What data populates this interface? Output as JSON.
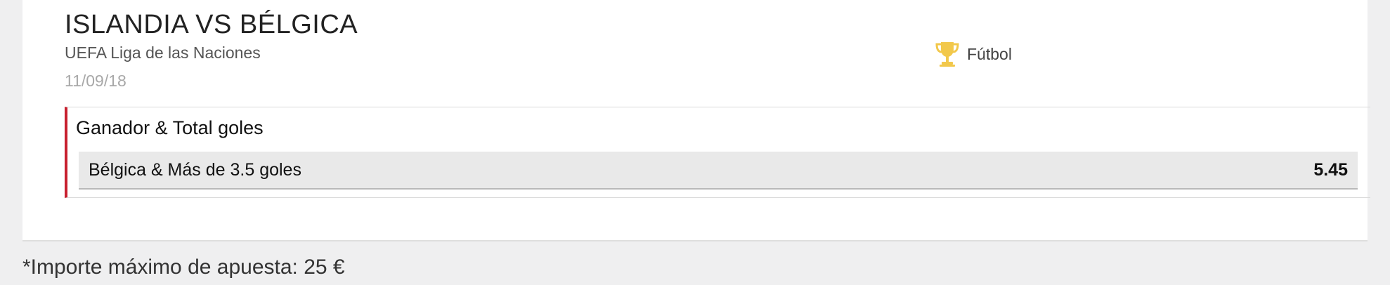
{
  "event": {
    "title": "ISLANDIA VS BÉLGICA",
    "competition": "UEFA Liga de las Naciones",
    "date": "11/09/18",
    "sport": {
      "label": "Fútbol",
      "icon": "trophy-icon"
    }
  },
  "market": {
    "title": "Ganador & Total goles",
    "selection": {
      "label": "Bélgica & Más de 3.5 goles",
      "odds": "5.45"
    }
  },
  "footnote": "*Importe máximo de apuesta: 25 €",
  "colors": {
    "accent": "#c8202f",
    "trophy": "#f2c84b",
    "background": "#efeff0"
  }
}
